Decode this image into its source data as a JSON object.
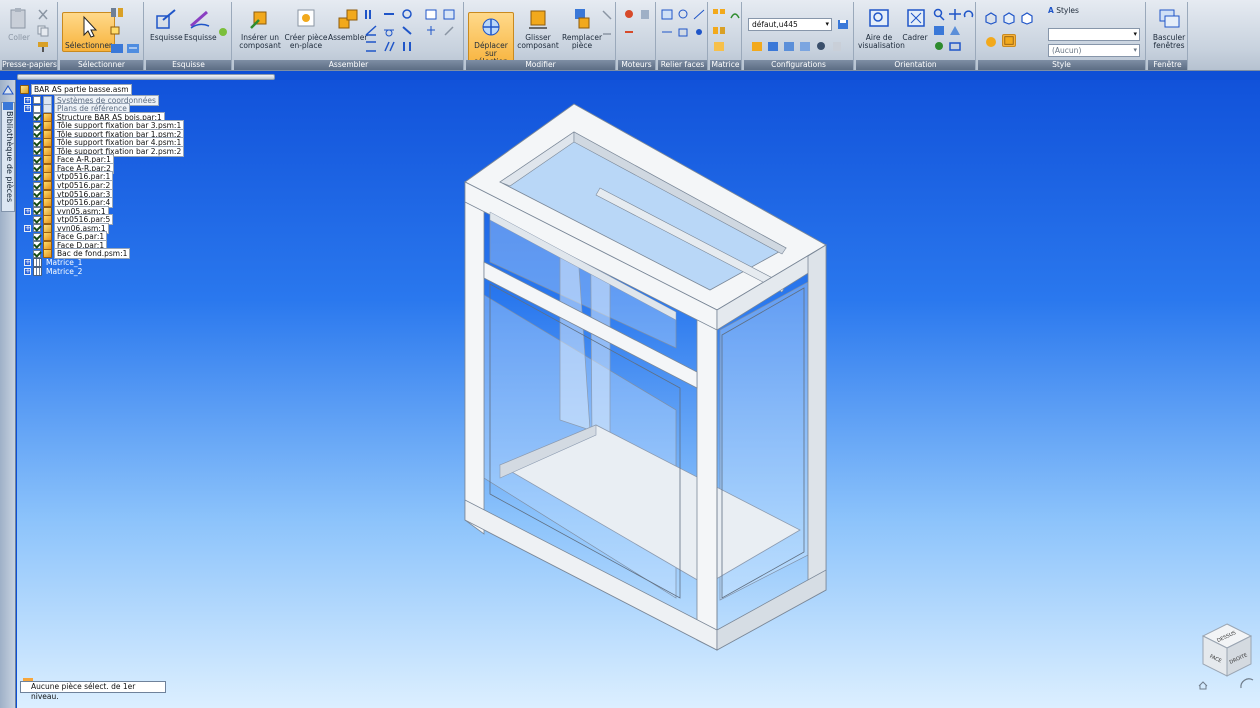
{
  "ribbon": {
    "groups": [
      {
        "label": "Presse-papiers",
        "buttons": [
          "Coller"
        ]
      },
      {
        "label": "Sélectionner",
        "buttons": [
          "Sélectionner"
        ]
      },
      {
        "label": "Esquisse",
        "buttons": [
          "Esquisse",
          "Esquisse"
        ]
      },
      {
        "label": "Assembler",
        "buttons": [
          "Insérer un composant",
          "Créer pièce en-place",
          "Assembler"
        ]
      },
      {
        "label": "Modifier",
        "buttons": [
          "Déplacer sur sélection",
          "Glisser composant",
          "Remplacer pièce"
        ]
      },
      {
        "label": "Moteurs",
        "buttons": []
      },
      {
        "label": "Relier faces",
        "buttons": []
      },
      {
        "label": "Matrice",
        "buttons": []
      },
      {
        "label": "Configurations",
        "buttons": []
      },
      {
        "label": "Orientation",
        "buttons": [
          "Aire de visualisation",
          "Cadrer"
        ]
      },
      {
        "label": "Style",
        "buttons": []
      },
      {
        "label": "Fenêtre",
        "buttons": [
          "Basculer fenêtres"
        ]
      }
    ],
    "configuration_value": "défaut,u445",
    "styles_label": "Styles",
    "style_value": "(Aucun)"
  },
  "side_tab": "Bibliothèque de pièces",
  "tree": {
    "root": "BAR AS partie basse.asm",
    "items": [
      {
        "label": "Systèmes de coordonnées",
        "kind": "coord",
        "expand": true,
        "checked": false,
        "dim": true
      },
      {
        "label": "Plans de référence",
        "kind": "coord",
        "expand": true,
        "checked": false,
        "dim": true
      },
      {
        "label": "Structure BAR AS bois.par:1",
        "kind": "part",
        "expand": false,
        "checked": true
      },
      {
        "label": "Tôle support fixation bar 3.psm:1",
        "kind": "part",
        "expand": false,
        "checked": true
      },
      {
        "label": "Tôle support fixation bar 1.psm:2",
        "kind": "part",
        "expand": false,
        "checked": true
      },
      {
        "label": "Tôle support fixation bar 4.psm:1",
        "kind": "part",
        "expand": false,
        "checked": true
      },
      {
        "label": "Tôle support fixation bar 2.psm:2",
        "kind": "part",
        "expand": false,
        "checked": true
      },
      {
        "label": "Face A-R.par:1",
        "kind": "part",
        "expand": false,
        "checked": true
      },
      {
        "label": "Face A-R.par:2",
        "kind": "part",
        "expand": false,
        "checked": true
      },
      {
        "label": "vtp0516.par:1",
        "kind": "part",
        "expand": false,
        "checked": true
      },
      {
        "label": "vtp0516.par:2",
        "kind": "part",
        "expand": false,
        "checked": true
      },
      {
        "label": "vtp0516.par:3",
        "kind": "part",
        "expand": false,
        "checked": true
      },
      {
        "label": "vtp0516.par:4",
        "kind": "part",
        "expand": false,
        "checked": true
      },
      {
        "label": "vyn05.asm:1",
        "kind": "asm",
        "expand": true,
        "checked": true
      },
      {
        "label": "vtp0516.par:5",
        "kind": "part",
        "expand": false,
        "checked": true
      },
      {
        "label": "vyn06.asm:1",
        "kind": "asm",
        "expand": true,
        "checked": true
      },
      {
        "label": "Face G.par:1",
        "kind": "part",
        "expand": false,
        "checked": true
      },
      {
        "label": "Face D.par:1",
        "kind": "part",
        "expand": false,
        "checked": true
      },
      {
        "label": "Bac de fond.psm:1",
        "kind": "part",
        "expand": false,
        "checked": true
      },
      {
        "label": "Matrice_1",
        "kind": "pattern",
        "expand": true,
        "checked": null
      },
      {
        "label": "Matrice_2",
        "kind": "pattern",
        "expand": true,
        "checked": null
      }
    ]
  },
  "status": "Aucune pièce sélect. de 1er niveau.",
  "viewcube": {
    "top": "DESSUS",
    "front": "FACE",
    "right": "DROITE"
  },
  "colors": {
    "accent": "#f7b23b",
    "viewport_top": "#1152da",
    "viewport_bottom": "#dcefff"
  }
}
